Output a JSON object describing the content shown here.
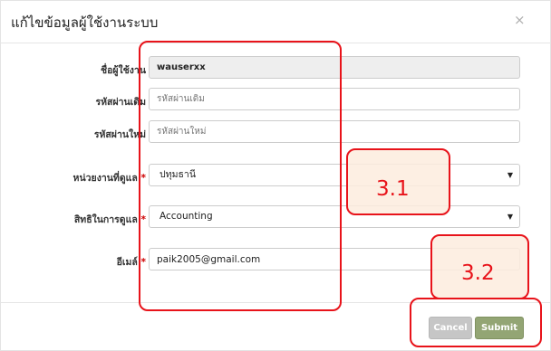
{
  "dialog": {
    "title": "แก้ไขข้อมูลผู้ใช้งานระบบ",
    "close_symbol": "×"
  },
  "form": {
    "username": {
      "label": "ชื่อผู้ใช้งาน",
      "value": "wauserxx"
    },
    "old_password": {
      "label": "รหัสผ่านเดิม",
      "placeholder": "รหัสผ่านเดิม"
    },
    "new_password": {
      "label": "รหัสผ่านใหม่",
      "placeholder": "รหัสผ่านใหม่"
    },
    "unit": {
      "label": "หน่วยงานที่ดูแล",
      "required_mark": "*",
      "selected": "ปทุมธานี"
    },
    "permission": {
      "label": "สิทธิในการดูแล",
      "required_mark": "*",
      "selected": "Accounting"
    },
    "email": {
      "label": "อีเมล์",
      "required_mark": "*",
      "value": "paik2005@gmail.com"
    }
  },
  "footer": {
    "cancel_label": "Cancel",
    "submit_label": "Submit"
  },
  "annotations": {
    "label_3_1": "3.1",
    "label_3_2": "3.2",
    "color": "#e8131a"
  },
  "colors": {
    "submit_button": "#93a574",
    "cancel_button": "#c6c6c6",
    "required_mark": "#cc0000"
  },
  "icons": {
    "close": "close-icon",
    "select_arrow": "caret-down-icon"
  }
}
